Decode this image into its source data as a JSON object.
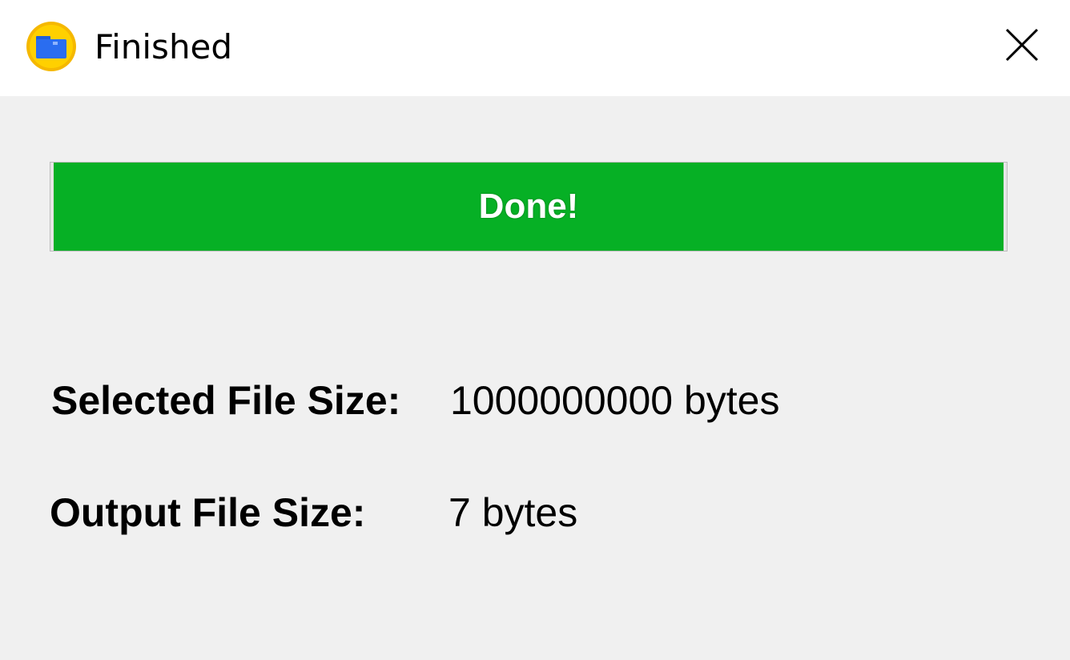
{
  "window": {
    "title": "Finished",
    "icon": "folder-app-icon",
    "close_icon": "close-icon"
  },
  "progress": {
    "label": "Done!",
    "fraction": 1.0,
    "color": "#06b025"
  },
  "info": {
    "selected_label": "Selected File Size:",
    "selected_value": "1000000000 bytes",
    "output_label": "Output File Size:",
    "output_value": "7 bytes"
  }
}
